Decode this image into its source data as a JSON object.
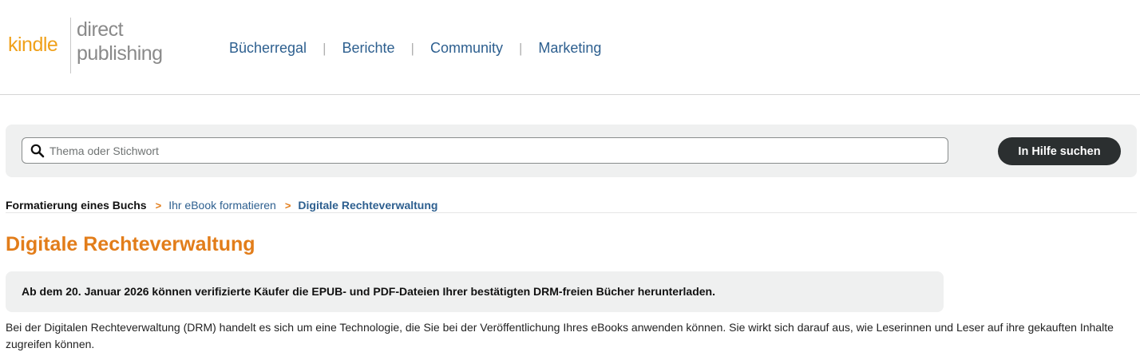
{
  "logo": {
    "kindle": "kindle",
    "direct": "direct",
    "publishing": "publishing"
  },
  "nav": {
    "items": [
      "Bücherregal",
      "Berichte",
      "Community",
      "Marketing"
    ],
    "separator": "|"
  },
  "search": {
    "placeholder": "Thema oder Stichwort",
    "value": "",
    "button_label": "In Hilfe suchen"
  },
  "breadcrumb": {
    "items": [
      "Formatierung eines Buchs",
      "Ihr eBook formatieren",
      "Digitale Rechteverwaltung"
    ],
    "separator": ">"
  },
  "page": {
    "title": "Digitale Rechteverwaltung",
    "notice": "Ab dem 20. Januar 2026 können verifizierte Käufer die EPUB- und PDF-Dateien Ihrer bestätigten DRM-freien Bücher herunterladen.",
    "body": "Bei der Digitalen Rechteverwaltung (DRM) handelt es sich um eine Technologie, die Sie bei der Veröffentlichung Ihres eBooks anwenden können. Sie wirkt sich darauf aus, wie Leserinnen und Leser auf ihre gekauften Inhalte zugreifen können."
  },
  "colors": {
    "accent_orange": "#e27d1a",
    "link_blue": "#2d5f8f",
    "kindle_orange": "#f0a11a",
    "button_dark": "#2b2f30",
    "panel_gray": "#eff0f0"
  },
  "icons": {
    "search": "search-icon"
  }
}
